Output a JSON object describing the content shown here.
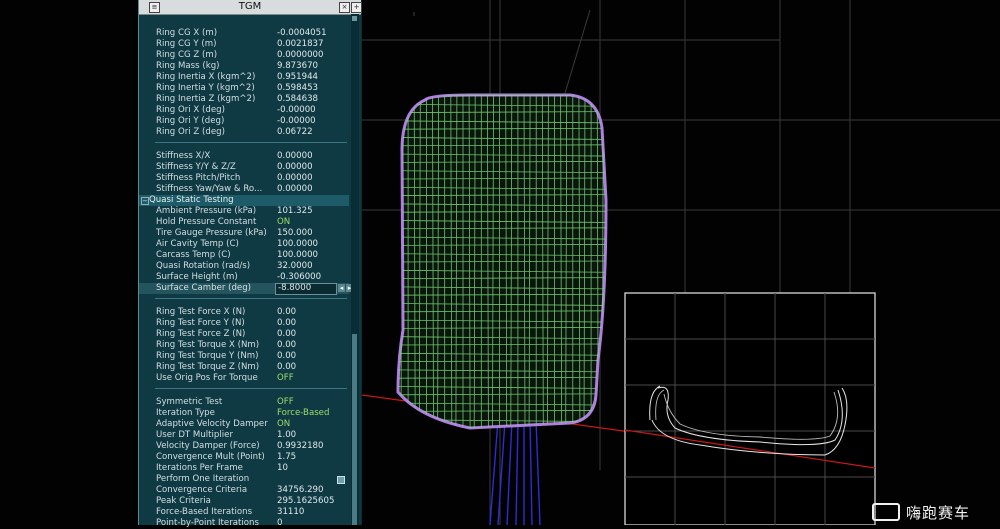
{
  "window": {
    "title": "TGM"
  },
  "sections": {
    "ring": [
      {
        "label": "Ring CG X (m)",
        "value": "-0.0004051"
      },
      {
        "label": "Ring CG Y (m)",
        "value": "0.0021837"
      },
      {
        "label": "Ring CG Z (m)",
        "value": "0.0000000"
      },
      {
        "label": "Ring Mass (kg)",
        "value": "9.873670"
      },
      {
        "label": "Ring Inertia X (kgm^2)",
        "value": "0.951944"
      },
      {
        "label": "Ring Inertia Y (kgm^2)",
        "value": "0.598453"
      },
      {
        "label": "Ring Inertia Z (kgm^2)",
        "value": "0.584638"
      },
      {
        "label": "Ring Ori X (deg)",
        "value": "-0.00000"
      },
      {
        "label": "Ring Ori Y (deg)",
        "value": "-0.00000"
      },
      {
        "label": "Ring Ori Z (deg)",
        "value": "0.06722"
      }
    ],
    "stiffness": [
      {
        "label": "Stiffness X/X",
        "value": "0.00000"
      },
      {
        "label": "Stiffness Y/Y & Z/Z",
        "value": "0.00000"
      },
      {
        "label": "Stiffness Pitch/Pitch",
        "value": "0.00000"
      },
      {
        "label": "Stiffness Yaw/Yaw & Ro...",
        "value": "0.00000"
      }
    ],
    "quasi_header": "Quasi Static Testing",
    "quasi": [
      {
        "label": "Ambient Pressure (kPa)",
        "value": "101.325"
      },
      {
        "label": "Hold Pressure Constant",
        "value": "ON",
        "green": true
      },
      {
        "label": "Tire Gauge Pressure (kPa)",
        "value": "150.000"
      },
      {
        "label": "Air Cavity Temp (C)",
        "value": "100.0000"
      },
      {
        "label": "Carcass Temp (C)",
        "value": "100.0000"
      },
      {
        "label": "Quasi Rotation (rad/s)",
        "value": "32.0000"
      },
      {
        "label": "Surface Height (m)",
        "value": "-0.306000"
      }
    ],
    "active_field": {
      "label": "Surface Camber (deg)",
      "value": "-8.8000"
    },
    "ring_test": [
      {
        "label": "Ring Test Force X (N)",
        "value": "0.00"
      },
      {
        "label": "Ring Test Force Y (N)",
        "value": "0.00"
      },
      {
        "label": "Ring Test Force Z (N)",
        "value": "0.00"
      },
      {
        "label": "Ring Test Torque X (Nm)",
        "value": "0.00"
      },
      {
        "label": "Ring Test Torque Y (Nm)",
        "value": "0.00"
      },
      {
        "label": "Ring Test Torque Z (Nm)",
        "value": "0.00"
      },
      {
        "label": "Use Orig Pos For Torque",
        "value": "OFF",
        "green": true
      }
    ],
    "solver": [
      {
        "label": "Symmetric Test",
        "value": "OFF",
        "green": true
      },
      {
        "label": "Iteration Type",
        "value": "Force-Based",
        "green": true
      },
      {
        "label": "Adaptive Velocity Damper",
        "value": "ON",
        "green": true
      },
      {
        "label": "User DT Multiplier",
        "value": "1.00"
      },
      {
        "label": "Velocity Damper (Force)",
        "value": "0.9932180"
      },
      {
        "label": "Convergence Mult (Point)",
        "value": "1.75"
      },
      {
        "label": "Iterations Per Frame",
        "value": "10"
      },
      {
        "label": "Perform One Iteration",
        "value": ""
      },
      {
        "label": "Convergence Criteria",
        "value": "34756.290"
      },
      {
        "label": "Peak Criteria",
        "value": "295.1625605"
      },
      {
        "label": "Force-Based Iterations",
        "value": "31110"
      },
      {
        "label": "Point-by-Point Iterations",
        "value": "0"
      }
    ]
  },
  "watermark": {
    "text": "嗨跑赛车"
  },
  "colors": {
    "panel_bg": "#0f3a44",
    "header_bg": "#1d5b68",
    "green_value": "#9fdc6a",
    "mesh_green": "#7fe37f",
    "outline_purple": "#b07ee0",
    "ground_red": "#d01818",
    "axis_blue": "#2a2ad8"
  }
}
